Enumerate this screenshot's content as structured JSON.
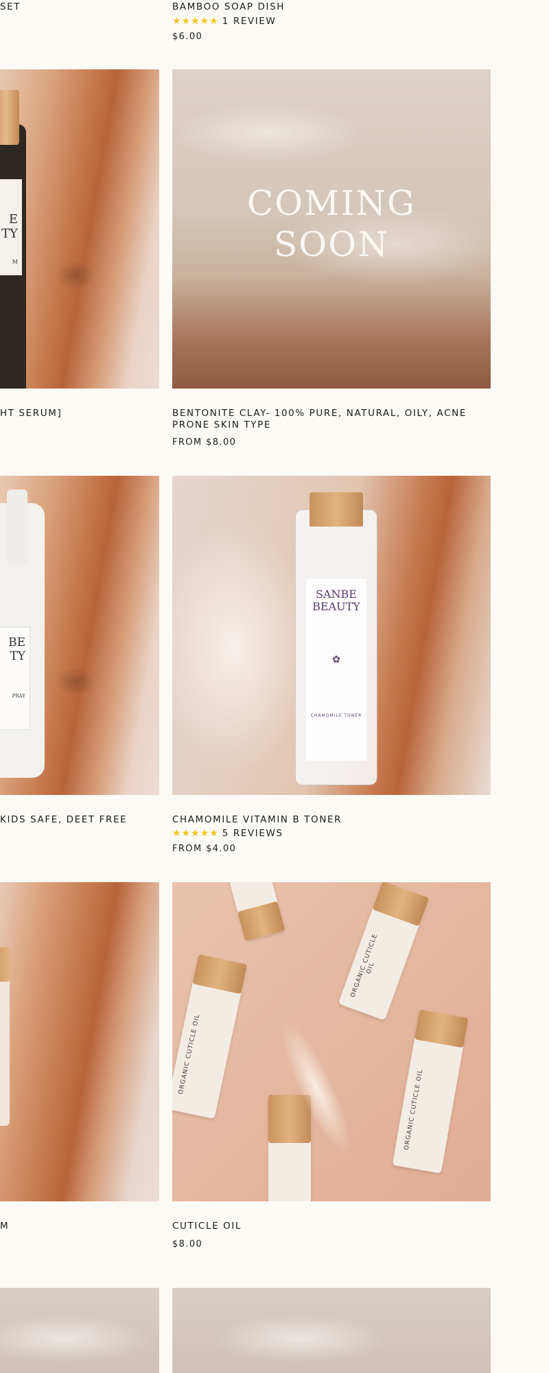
{
  "products": [
    {
      "title": "SET",
      "price": ""
    },
    {
      "title": "BAMBOO SOAP DISH",
      "stars": "★★★★★",
      "reviews": "1 REVIEW",
      "price": "$6.00"
    },
    {
      "title": "HT SERUM]",
      "image_text": {
        "brand1": "E",
        "brand2": "TY",
        "small": "M"
      }
    },
    {
      "title": "BENTONITE CLAY- 100% PURE, NATURAL, OILY, ACNE PRONE SKIN TYPE",
      "price": "FROM $8.00",
      "image_text": {
        "overlay": "COMING SOON"
      }
    },
    {
      "title": "KIDS SAFE, DEET FREE",
      "image_text": {
        "brand1": "BE",
        "brand2": "TY",
        "small": "PRAY"
      }
    },
    {
      "title": "CHAMOMILE VITAMIN B TONER",
      "stars": "★★★★★",
      "reviews": "5 REVIEWS",
      "price": "FROM $4.00",
      "image_text": {
        "brand": "SANBE BEAUTY",
        "sub": "CHAMOMILE TONER"
      }
    },
    {
      "title": "M"
    },
    {
      "title": "CUTICLE OIL",
      "price": "$8.00",
      "image_text": {
        "roller": "ORGANIC CUTICLE OIL"
      }
    }
  ],
  "colors": {
    "background": "#fcfaf5",
    "star": "#f2c51b"
  }
}
